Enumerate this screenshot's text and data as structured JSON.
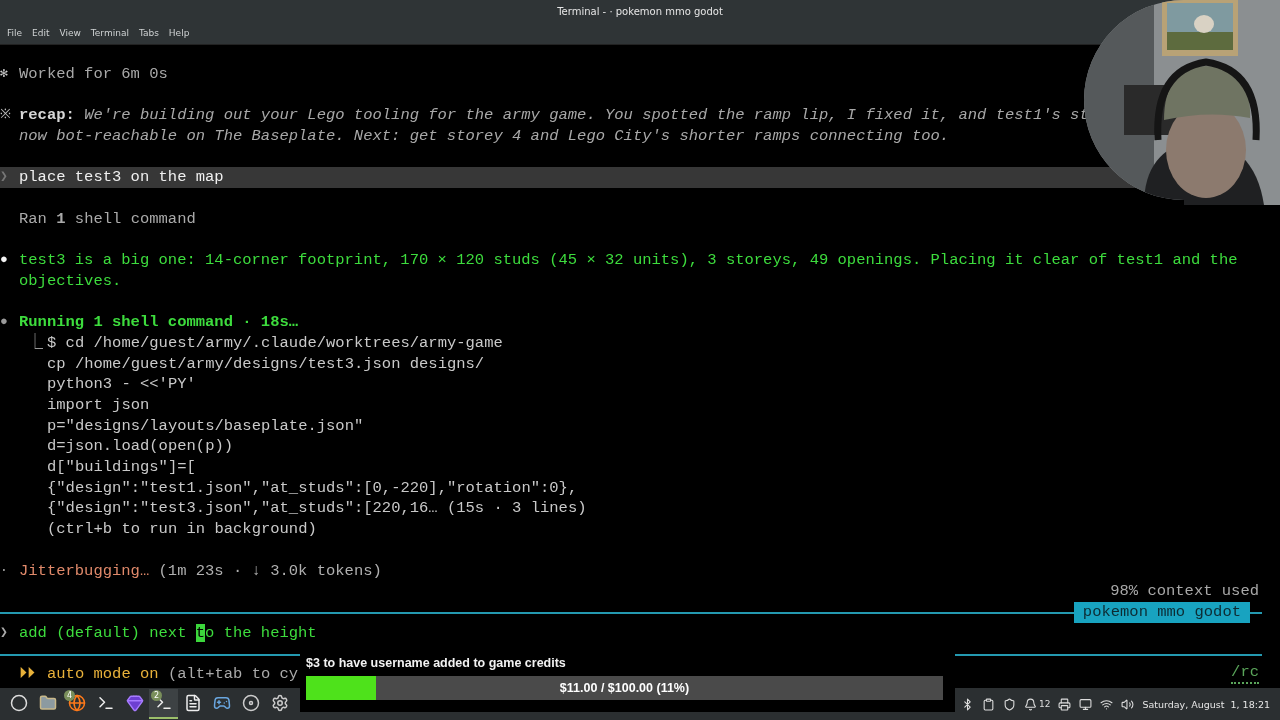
{
  "window": {
    "title": "Terminal - · pokemon mmo godot"
  },
  "menu": [
    "File",
    "Edit",
    "View",
    "Terminal",
    "Tabs",
    "Help"
  ],
  "blocks": [
    {
      "kind": "status",
      "bullet": "✻",
      "lines": [
        "Worked for 6m 0s"
      ]
    },
    {
      "kind": "recap",
      "bullet": "※",
      "label": "recap:",
      "lines": [
        "We're building out your Lego tooling for the army game. You spotted the ramp lip, I fixed it, and test1's st",
        "now bot-reachable on The Baseplate. Next: get storey 4 and Lego City's shorter ramps connecting too."
      ]
    },
    {
      "kind": "prompt",
      "bullet": "❯",
      "lines": [
        "place test3 on the map"
      ]
    },
    {
      "kind": "info",
      "lines": [
        "Ran **1** shell command"
      ]
    },
    {
      "kind": "message",
      "bullet": "●",
      "lines": [
        "test3 is a big one: 14-corner footprint, 170 × 120 studs (45 × 32 units), 3 storeys, 49 openings. Placing it clear of test1 and the",
        "objectives."
      ]
    },
    {
      "kind": "tool",
      "bullet": "●",
      "lines": [
        "Running 1 shell command · 18s…"
      ]
    },
    {
      "kind": "output",
      "bullet": "⎿",
      "lines": [
        "$ cd /home/guest/army/.claude/worktrees/army-game",
        "cp /home/guest/army/designs/test3.json designs/",
        "python3 - <<'PY'",
        "import json",
        "p=\"designs/layouts/baseplate.json\"",
        "d=json.load(open(p))",
        "d[\"buildings\"]=[",
        "{\"design\":\"test1.json\",\"at_studs\":[0,-220],\"rotation\":0},",
        "{\"design\":\"test3.json\",\"at_studs\":[220,16… (15s · 3 lines)",
        "(ctrl+b to run in background)"
      ]
    },
    {
      "kind": "spinner",
      "bullet": "·",
      "label": "Jitterbugging…",
      "lines": [
        "(1m 23s · ↓ 3.0k tokens)"
      ]
    }
  ],
  "context": "98% context used",
  "session_badge": "pokemon mmo godot",
  "input": {
    "prompt": "❯",
    "before_cursor": "add (default) next ",
    "cursor": "t",
    "after_cursor": "o the height"
  },
  "mode": {
    "icon": "⏵⏵",
    "label": "auto mode on",
    "hint": "(alt+tab to cy",
    "command": "/rc"
  },
  "donation": {
    "title": "$3 to have username added to game credits",
    "level": 0.11,
    "reading": "$11.00 / $100.00 (11%)"
  },
  "taskbar": {
    "apps": [
      {
        "kind": "menu",
        "active": false
      },
      {
        "kind": "files",
        "active": false
      },
      {
        "kind": "browser",
        "active": false,
        "badge": "4"
      },
      {
        "kind": "terminal",
        "active": false
      },
      {
        "kind": "gem",
        "active": false
      },
      {
        "kind": "terminal",
        "active": true,
        "badge": "2"
      },
      {
        "kind": "document",
        "active": false
      },
      {
        "kind": "game",
        "active": false
      },
      {
        "kind": "disc",
        "active": false
      },
      {
        "kind": "gear",
        "active": false
      }
    ],
    "tray": [
      {
        "kind": "bluetooth"
      },
      {
        "kind": "clipboard"
      },
      {
        "kind": "shield"
      },
      {
        "kind": "bell",
        "count": "12"
      },
      {
        "kind": "printer"
      },
      {
        "kind": "display"
      },
      {
        "kind": "wifi"
      },
      {
        "kind": "volume"
      }
    ],
    "clock": "Saturday, August  1, 18:21"
  }
}
